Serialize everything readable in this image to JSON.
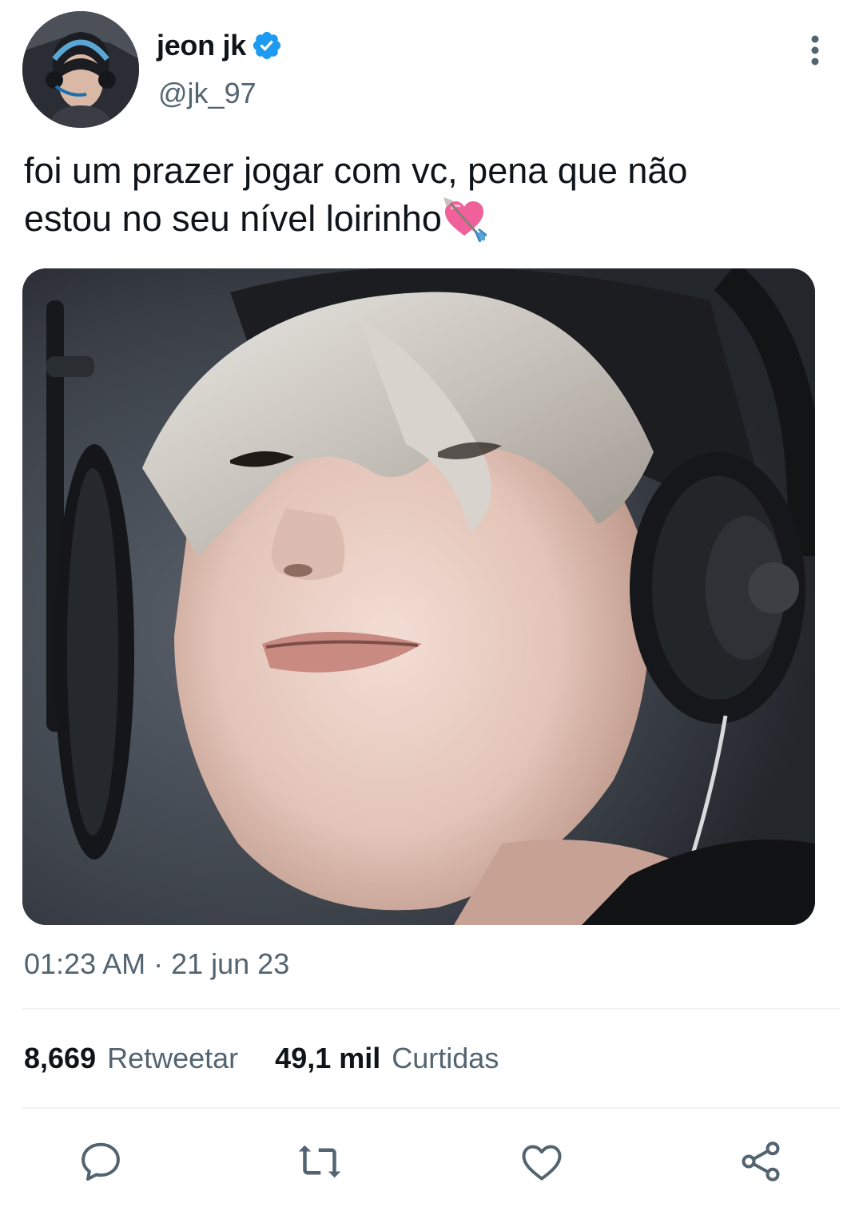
{
  "tweet": {
    "author": {
      "display_name": "jeon jk",
      "handle": "@jk_97",
      "verified": true
    },
    "text_line_1": "foi um prazer jogar com vc, pena que não",
    "text_line_2": "estou no seu nível loirinho",
    "emoji": "heart-with-arrow-emoji",
    "timestamp": "01:23 AM · 21 jun 23",
    "stats": {
      "retweets_value": "8,669",
      "retweets_label": "Retweetar",
      "likes_value": "49,1 mil",
      "likes_label": "Curtidas"
    }
  },
  "icons": {
    "more": "more-vertical-icon",
    "reply": "reply-icon",
    "retweet": "retweet-icon",
    "like": "heart-icon",
    "share": "share-icon",
    "verified": "verified-badge-icon"
  },
  "colors": {
    "text_primary": "#0f1419",
    "text_secondary": "#536471",
    "verified_blue": "#1d9bf0",
    "divider": "#eff3f4",
    "icon_gray": "#536471"
  }
}
